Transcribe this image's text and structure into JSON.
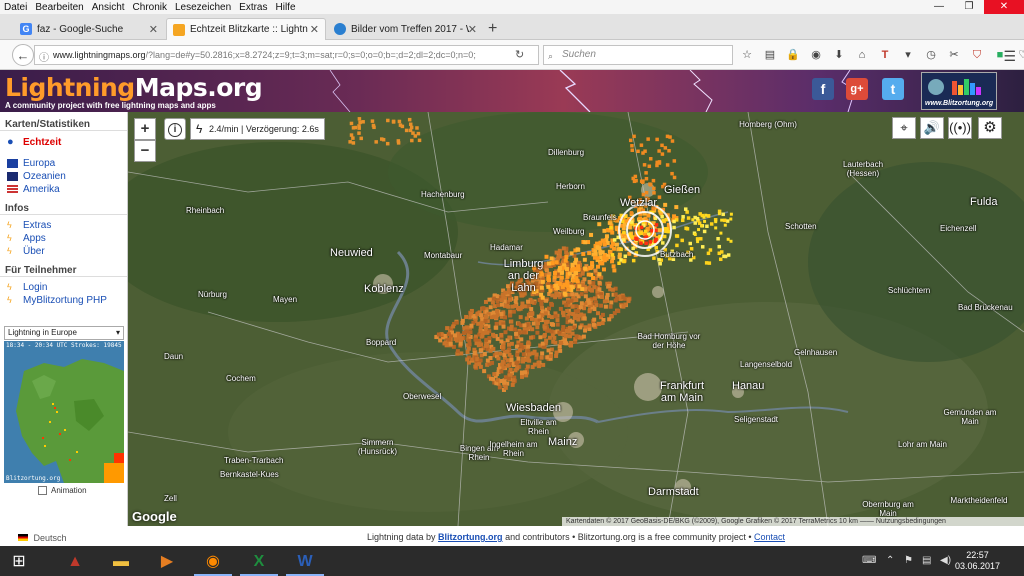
{
  "menubar": [
    "Datei",
    "Bearbeiten",
    "Ansicht",
    "Chronik",
    "Lesezeichen",
    "Extras",
    "Hilfe"
  ],
  "tabs": [
    {
      "label": "faz - Google-Suche",
      "fav_color": "#4285f4"
    },
    {
      "label": "Echtzeit Blitzkarte :: Lightning",
      "fav_color": "#f5a623"
    },
    {
      "label": "Bilder vom Treffen 2017 - W",
      "fav_color": "#2a7fd0"
    }
  ],
  "nav": {
    "url_domain": "www.lightningmaps.org",
    "url_rest": "/?lang=de#y=50.2816;x=8.2724;z=9;t=3;m=sat;r=0;s=0;o=0;b=;d=2;dl=2;dc=0;n=0;",
    "search_placeholder": "Suchen"
  },
  "header": {
    "logo_part1": "Lightning",
    "logo_part2": "Maps.org",
    "tagline": "A community project with free lightning maps and apps",
    "partner_logo_text": "www.Blitzortung.org"
  },
  "sidebar": {
    "h1": "Karten/Statistiken",
    "realtime": "Echtzeit",
    "maps": [
      "Europa",
      "Ozeanien",
      "Amerika"
    ],
    "h2": "Infos",
    "infos": [
      "Extras",
      "Apps",
      "Über"
    ],
    "h3": "Für Teilnehmer",
    "members": [
      "Login",
      "MyBlitzortung PHP"
    ],
    "select_value": "Lightning in Europe",
    "minimap_text": "18:34 - 20:34 UTC  Strokes: 19845",
    "minimap_footer": "Blitzortung.org",
    "animation_label": "Animation",
    "language": "Deutsch"
  },
  "map": {
    "zoom_in": "+",
    "zoom_out": "−",
    "info": "i",
    "rate_text": "2.4/min | Verzögerung: 2.6s",
    "google": "Google",
    "attribution": "Kartendaten © 2017 GeoBasis-DE/BKG (©2009), Google Grafiken © 2017 TerraMetrics   10 km ——  Nutzungsbedingungen",
    "cities": [
      {
        "n": "Dillenburg"
      },
      {
        "n": "Herborn"
      },
      {
        "n": "Hachenburg"
      },
      {
        "n": "Rheinbach"
      },
      {
        "n": "Homberg (Ohm)"
      },
      {
        "n": "Lauterbach (Hessen)"
      },
      {
        "n": "Gießen"
      },
      {
        "n": "Wetzlar"
      },
      {
        "n": "Braunfels"
      },
      {
        "n": "Weilburg"
      },
      {
        "n": "Hadamar"
      },
      {
        "n": "Montabaur"
      },
      {
        "n": "Neuwied"
      },
      {
        "n": "Limburg an der Lahn"
      },
      {
        "n": "Butzbach"
      },
      {
        "n": "Schotten"
      },
      {
        "n": "Fulda"
      },
      {
        "n": "Eichenzell"
      },
      {
        "n": "Koblenz"
      },
      {
        "n": "Mayen"
      },
      {
        "n": "Nürburg"
      },
      {
        "n": "Schlüchtern"
      },
      {
        "n": "Bad Brückenau"
      },
      {
        "n": "Boppard"
      },
      {
        "n": "Bad Homburg vor der Höhe"
      },
      {
        "n": "Gelnhausen"
      },
      {
        "n": "Langenselbold"
      },
      {
        "n": "Daun"
      },
      {
        "n": "Cochem"
      },
      {
        "n": "Oberwesel"
      },
      {
        "n": "Frankfurt am Main"
      },
      {
        "n": "Hanau"
      },
      {
        "n": "Wiesbaden"
      },
      {
        "n": "Seligenstadt"
      },
      {
        "n": "Gemünden am Main"
      },
      {
        "n": "Lohr am Main"
      },
      {
        "n": "Simmern (Hunsrück)"
      },
      {
        "n": "Eltville am Rhein"
      },
      {
        "n": "Mainz"
      },
      {
        "n": "Bingen am Rhein"
      },
      {
        "n": "Ingelheim am Rhein"
      },
      {
        "n": "Traben-Trarbach"
      },
      {
        "n": "Bernkastel-Kues"
      },
      {
        "n": "Darmstadt"
      },
      {
        "n": "Obernburg am Main"
      },
      {
        "n": "Marktheidenfeld"
      },
      {
        "n": "Zell"
      }
    ]
  },
  "footer": {
    "pre": "Lightning data by",
    "link": "Blitzortung.org",
    "mid": "and contributors • Blitzortung.org is a free community project •",
    "contact": "Contact"
  },
  "taskbar": {
    "time": "22:57",
    "date": "03.06.2017"
  }
}
